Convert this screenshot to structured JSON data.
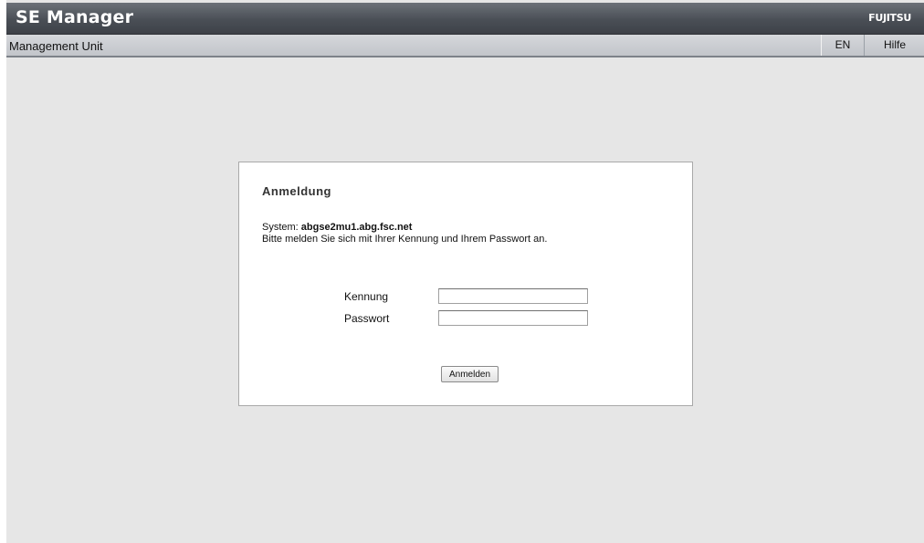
{
  "header": {
    "app_title": "SE Manager",
    "brand": "FUJITSU"
  },
  "subheader": {
    "title": "Management Unit",
    "language_label": "EN",
    "help_label": "Hilfe"
  },
  "login": {
    "heading": "Anmeldung",
    "system_prefix": "System:",
    "system_name": "abgse2mu1.abg.fsc.net",
    "instruction": "Bitte melden Sie sich mit Ihrer Kennung und Ihrem Passwort an.",
    "username_label": "Kennung",
    "username_value": "",
    "password_label": "Passwort",
    "password_value": "",
    "submit_label": "Anmelden"
  },
  "colors": {
    "header_dark": "#4a4f56",
    "subheader": "#c8cbcf",
    "page_background": "#e6e6e6",
    "panel_background": "#ffffff"
  }
}
